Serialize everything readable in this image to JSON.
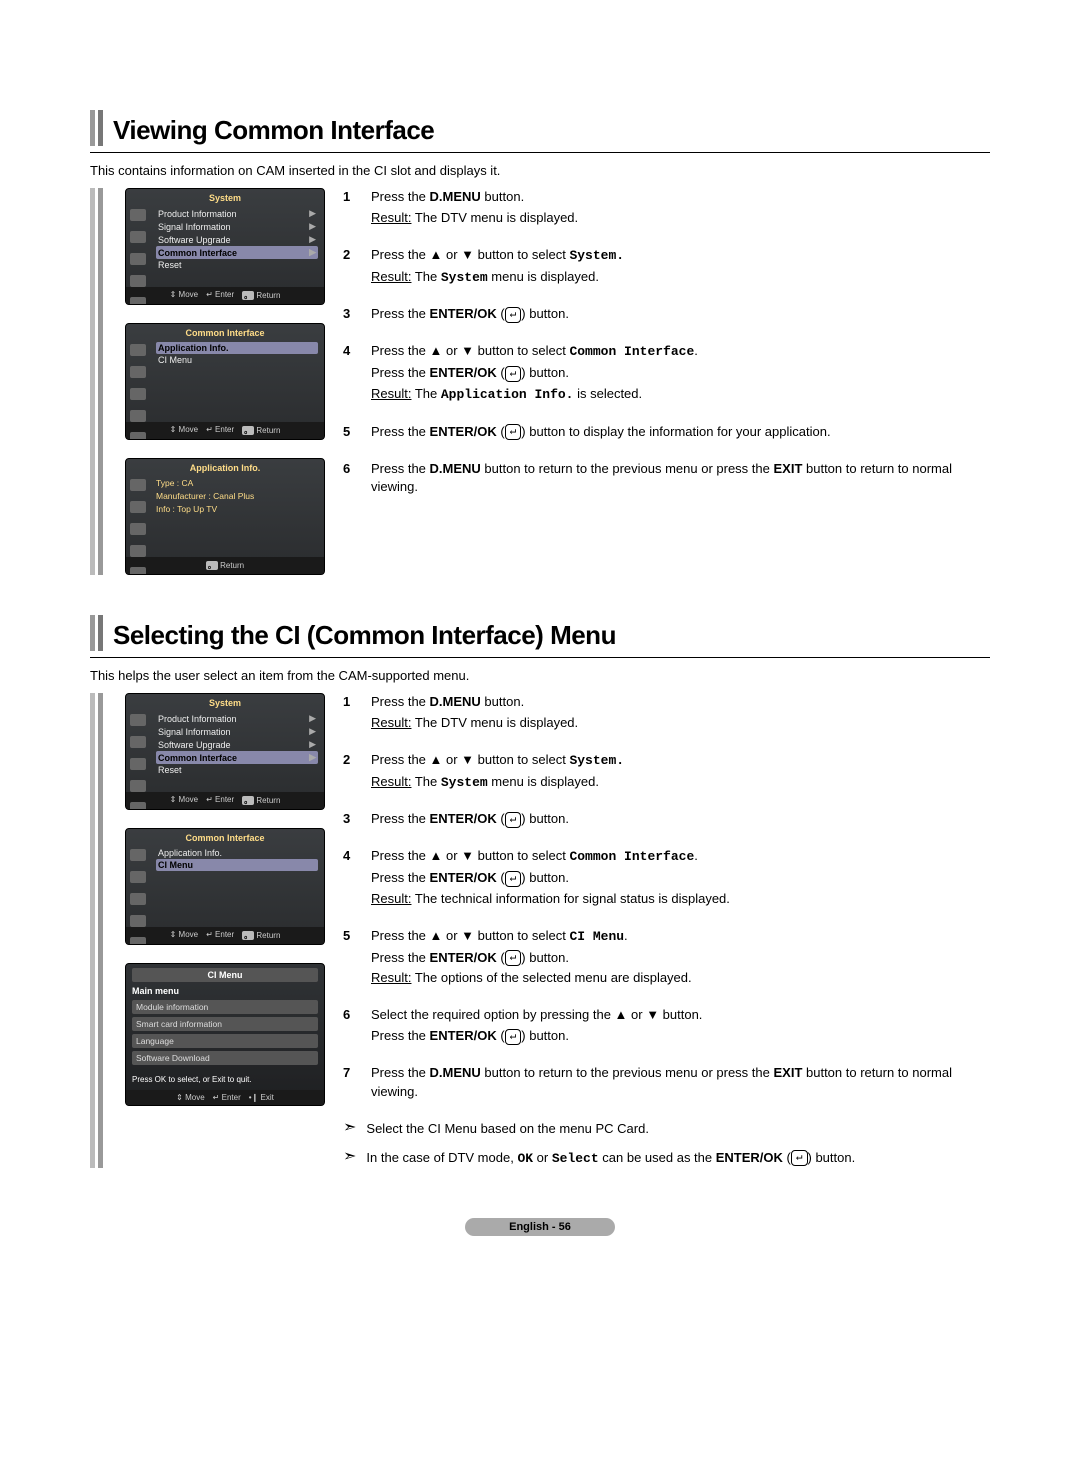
{
  "section1": {
    "title": "Viewing Common Interface",
    "intro": "This contains information on CAM inserted in the CI slot and displays it.",
    "steps": {
      "s1a": "Press the ",
      "s1b": "D.MENU",
      "s1c": " button.",
      "s1r": "Result:",
      "s1rt": "  The DTV menu is displayed.",
      "s2a": "Press the ▲ or ▼ button to select ",
      "s2m": "System.",
      "s2r": "Result:",
      "s2rt1": "  The ",
      "s2rt2": "System",
      "s2rt3": " menu is displayed.",
      "s3a": "Press the ",
      "s3b": "ENTER/OK",
      "s3c": " (",
      "s3d": ") button.",
      "s4a": "Press the ▲ or ▼ button to select ",
      "s4m": "Common Interface",
      "s4c": ".",
      "s4p1a": "Press the ",
      "s4p1b": "ENTER/OK",
      "s4p1c": " (",
      "s4p1d": ") button.",
      "s4r": "Result:",
      "s4rt1": "  The ",
      "s4rt2": "Application Info.",
      "s4rt3": " is selected.",
      "s5a": "Press the ",
      "s5b": "ENTER/OK",
      "s5c": " (",
      "s5d": ") button to display the information for your application.",
      "s6a": "Press the ",
      "s6b": "D.MENU",
      "s6c": " button to return to the previous menu or press the ",
      "s6d": "EXIT",
      "s6e": " button to return to normal viewing."
    },
    "osd1": {
      "title": "System",
      "items": [
        "Product Information",
        "Signal Information",
        "Software Upgrade",
        "Common Interface",
        "Reset"
      ],
      "foot": {
        "move": "Move",
        "enter": "Enter",
        "return": "Return"
      }
    },
    "osd2": {
      "title": "Common Interface",
      "items": [
        "Application Info.",
        "CI Menu"
      ],
      "foot": {
        "move": "Move",
        "enter": "Enter",
        "return": "Return"
      }
    },
    "osd3": {
      "title": "Application Info.",
      "lines": [
        "Type : CA",
        "Manufacturer : Canal Plus",
        "Info : Top Up TV"
      ],
      "foot": {
        "return": "Return"
      }
    }
  },
  "section2": {
    "title": "Selecting the CI (Common Interface) Menu",
    "intro": "This helps the user select an item from the CAM-supported menu.",
    "steps": {
      "s1a": "Press the ",
      "s1b": "D.MENU",
      "s1c": " button.",
      "s1r": "Result:",
      "s1rt": "  The DTV menu is displayed.",
      "s2a": "Press the ▲ or ▼ button to select ",
      "s2m": "System.",
      "s2r": "Result:",
      "s2rt1": "  The ",
      "s2rt2": "System",
      "s2rt3": " menu is displayed.",
      "s3a": "Press the ",
      "s3b": "ENTER/OK",
      "s3c": " (",
      "s3d": ") button.",
      "s4a": "Press the ▲ or ▼ button to select ",
      "s4m": "Common Interface",
      "s4c": ".",
      "s4p1a": "Press the ",
      "s4p1b": "ENTER/OK",
      "s4p1c": " (",
      "s4p1d": ") button.",
      "s4r": "Result:",
      "s4rt": "  The technical information for signal status is displayed.",
      "s5a": "Press the ▲ or ▼ button to select ",
      "s5m": "CI Menu",
      "s5c": ".",
      "s5p1a": "Press the ",
      "s5p1b": "ENTER/OK",
      "s5p1c": " (",
      "s5p1d": ") button.",
      "s5r": "Result:",
      "s5rt": "  The options of the selected menu are displayed.",
      "s6a": "Select the required option by pressing the ▲ or ▼ button.",
      "s6p1a": "Press the ",
      "s6p1b": "ENTER/OK",
      "s6p1c": " (",
      "s6p1d": ") button.",
      "s7a": "Press the ",
      "s7b": "D.MENU",
      "s7c": " button to return to the previous menu or press the ",
      "s7d": "EXIT",
      "s7e": " button to return to normal viewing."
    },
    "notes": {
      "n1": "Select the CI Menu based on the menu PC Card.",
      "n2a": "In the case of DTV mode, ",
      "n2b": "OK",
      "n2c": " or ",
      "n2d": "Select",
      "n2e": " can be used as the ",
      "n2f": "ENTER/OK",
      "n2g": " (",
      "n2h": ") button."
    },
    "osd1": {
      "title": "System",
      "items": [
        "Product Information",
        "Signal Information",
        "Software Upgrade",
        "Common Interface",
        "Reset"
      ],
      "foot": {
        "move": "Move",
        "enter": "Enter",
        "return": "Return"
      }
    },
    "osd2": {
      "title": "Common Interface",
      "items": [
        "Application Info.",
        "CI Menu"
      ],
      "foot": {
        "move": "Move",
        "enter": "Enter",
        "return": "Return"
      }
    },
    "osd3": {
      "title": "CI Menu",
      "head": "Main menu",
      "items": [
        "Module information",
        "Smart card information",
        "Language",
        "Software Download"
      ],
      "hint": "Press OK to select, or Exit to quit.",
      "foot": {
        "move": "Move",
        "enter": "Enter",
        "exit": "Exit"
      }
    }
  },
  "glyphs": {
    "enter": "↵",
    "updown": "⇕",
    "exit": "•❙"
  },
  "footer": "English - 56"
}
